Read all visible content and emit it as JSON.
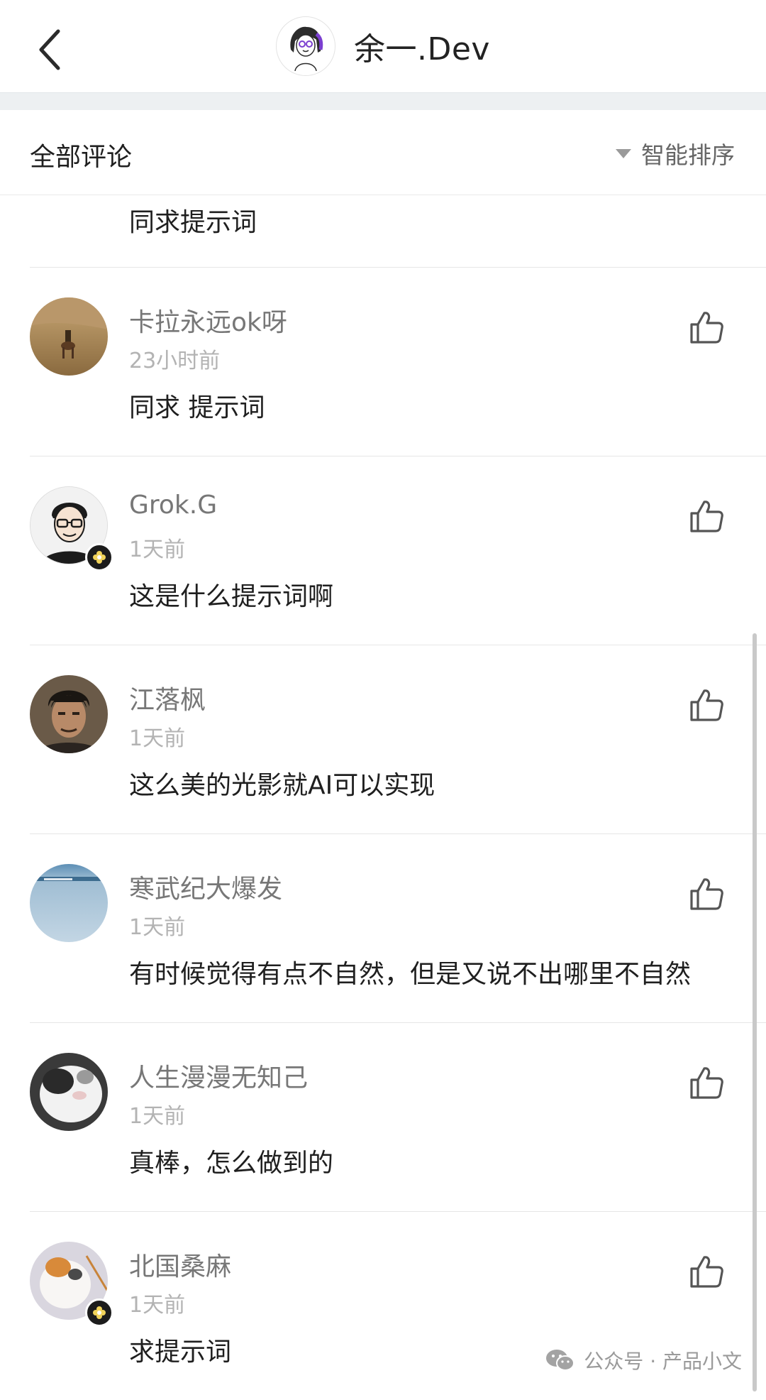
{
  "header": {
    "title": "余一.Dev",
    "back_icon": "chevron-left-icon",
    "avatar_icon": "cartoon-girl-avatar"
  },
  "comments_section": {
    "title": "全部评论",
    "sort_label": "智能排序",
    "sort_icon": "caret-down-icon",
    "partial_comment_text": "同求提示词"
  },
  "comments": [
    {
      "name": "卡拉永远ok呀",
      "time": "23小时前",
      "text": "同求 提示词",
      "badge": false
    },
    {
      "name": "Grok.G",
      "time": "1天前",
      "text": "这是什么提示词啊",
      "badge": true
    },
    {
      "name": "江落枫",
      "time": "1天前",
      "text": "这么美的光影就AI可以实现",
      "badge": false
    },
    {
      "name": "寒武纪大爆发",
      "time": "1天前",
      "text": "有时候觉得有点不自然，但是又说不出哪里不自然",
      "badge": false
    },
    {
      "name": "人生漫漫无知己",
      "time": "1天前",
      "text": "真棒，怎么做到的",
      "badge": false
    },
    {
      "name": "北国桑麻",
      "time": "1天前",
      "text": "求提示词",
      "badge": true
    }
  ],
  "watermark": {
    "text": "公众号 · 产品小文",
    "icon": "wechat-icon"
  },
  "colors": {
    "text_primary": "#1f1f1f",
    "text_name": "#777777",
    "text_time": "#b3b3b3",
    "divider": "#e6e6e6"
  }
}
